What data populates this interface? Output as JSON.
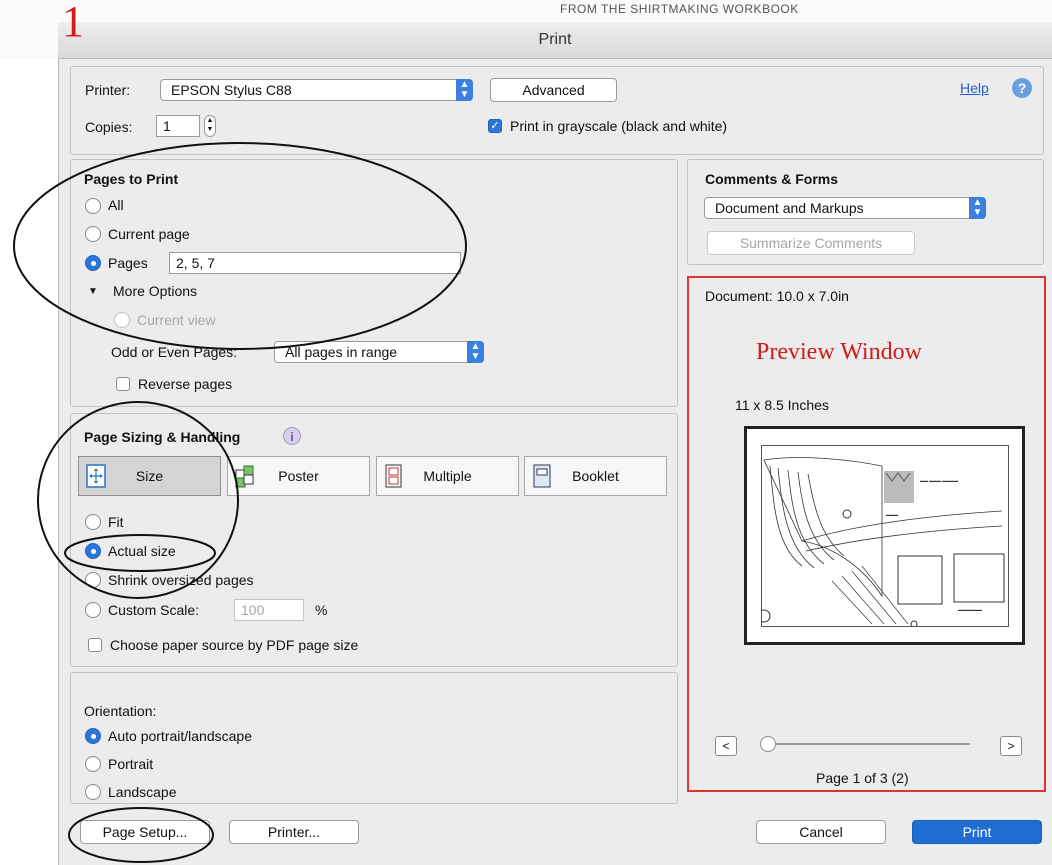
{
  "background": {
    "cut_text": "FROM THE SHIRTMAKING WORKBOOK"
  },
  "annotation": {
    "number": "1",
    "preview_label": "Preview Window"
  },
  "window": {
    "title": "Print"
  },
  "top": {
    "printer_label": "Printer:",
    "printer_value": "EPSON Stylus C88",
    "advanced_label": "Advanced",
    "help_label": "Help",
    "help_icon": "?",
    "copies_label": "Copies:",
    "copies_value": "1",
    "grayscale_label": "Print in grayscale (black and white)",
    "grayscale_checked": true
  },
  "pages_to_print": {
    "title": "Pages to Print",
    "all_label": "All",
    "current_page_label": "Current page",
    "pages_label": "Pages",
    "pages_value": "2, 5, 7",
    "selected": "Pages",
    "more_options_label": "More Options",
    "current_view_label": "Current view",
    "odd_even_label": "Odd or Even Pages:",
    "odd_even_value": "All pages in range",
    "reverse_label": "Reverse pages",
    "reverse_checked": false
  },
  "sizing": {
    "title": "Page Sizing & Handling",
    "info_icon": "i",
    "modes": [
      {
        "label": "Size",
        "icon": "size-icon"
      },
      {
        "label": "Poster",
        "icon": "poster-icon"
      },
      {
        "label": "Multiple",
        "icon": "multiple-icon"
      },
      {
        "label": "Booklet",
        "icon": "booklet-icon"
      }
    ],
    "selected_mode": "Size",
    "fit_label": "Fit",
    "actual_size_label": "Actual size",
    "shrink_label": "Shrink oversized pages",
    "custom_scale_label": "Custom Scale:",
    "custom_scale_value": "100",
    "percent_label": "%",
    "selected_option": "Actual size",
    "paper_source_label": "Choose paper source by PDF page size",
    "paper_source_checked": false
  },
  "orientation": {
    "title": "Orientation:",
    "auto_label": "Auto portrait/landscape",
    "portrait_label": "Portrait",
    "landscape_label": "Landscape",
    "selected": "Auto portrait/landscape"
  },
  "comments": {
    "title": "Comments & Forms",
    "value": "Document and Markups",
    "summarize_label": "Summarize Comments"
  },
  "preview": {
    "document_label": "Document: 10.0 x 7.0in",
    "paper_label": "11 x 8.5 Inches",
    "prev_label": "<",
    "next_label": ">",
    "page_status": "Page 1 of 3 (2)",
    "slider_position": 0
  },
  "footer": {
    "page_setup_label": "Page Setup...",
    "printer_label": "Printer...",
    "cancel_label": "Cancel",
    "print_label": "Print"
  },
  "colors": {
    "accent": "#2d75d8",
    "print_button": "#1f6dd0",
    "annotation_red": "#d21a1a"
  }
}
